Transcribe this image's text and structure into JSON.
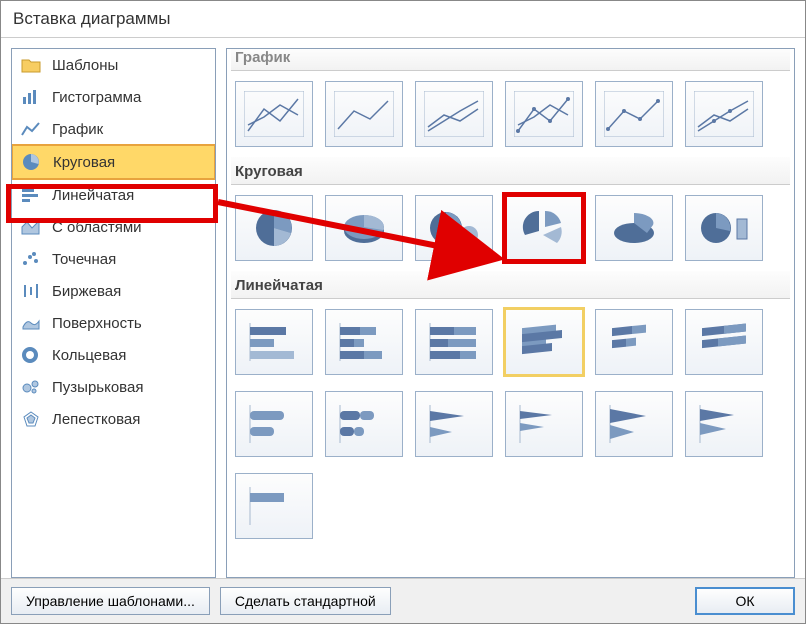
{
  "title": "Вставка диаграммы",
  "sidebar": {
    "items": [
      {
        "label": "Шаблоны",
        "icon": "folder"
      },
      {
        "label": "Гистограмма",
        "icon": "bar-v"
      },
      {
        "label": "График",
        "icon": "line"
      },
      {
        "label": "Круговая",
        "icon": "pie",
        "selected": true
      },
      {
        "label": "Линейчатая",
        "icon": "bar-h"
      },
      {
        "label": "С областями",
        "icon": "area"
      },
      {
        "label": "Точечная",
        "icon": "scatter"
      },
      {
        "label": "Биржевая",
        "icon": "stock"
      },
      {
        "label": "Поверхность",
        "icon": "surface"
      },
      {
        "label": "Кольцевая",
        "icon": "donut"
      },
      {
        "label": "Пузырьковая",
        "icon": "bubble"
      },
      {
        "label": "Лепестковая",
        "icon": "radar"
      }
    ]
  },
  "sections": {
    "clipped_top": "График",
    "pie": "Круговая",
    "bar": "Линейчатая"
  },
  "footer": {
    "manage_templates": "Управление шаблонами...",
    "set_default": "Сделать стандартной",
    "ok": "ОК"
  },
  "highlighted_pie_index": 3,
  "highlighted_bar_index": 3
}
